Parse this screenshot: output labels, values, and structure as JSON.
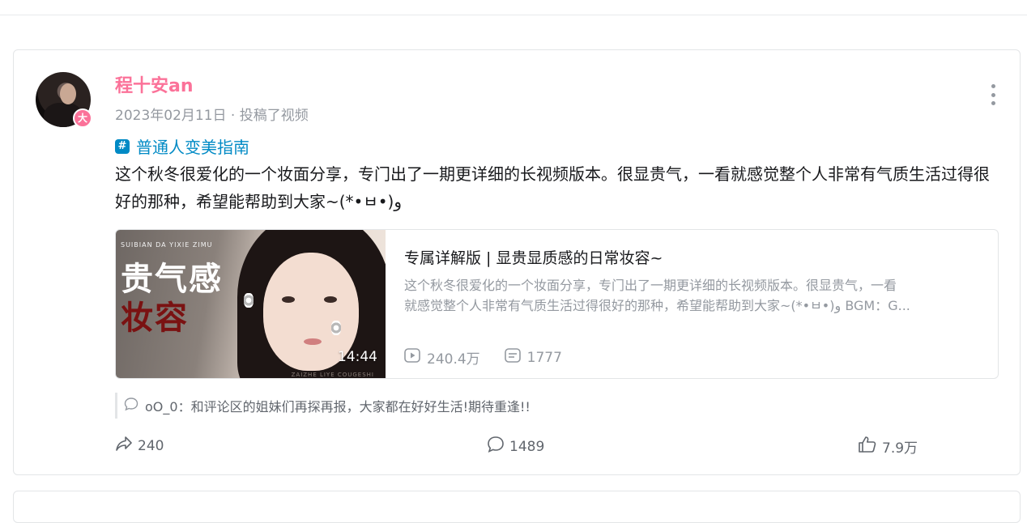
{
  "post": {
    "author": {
      "name": "程十安an",
      "badge": "大"
    },
    "meta": "2023年02月11日 · 投稿了视频",
    "topic": "普通人变美指南",
    "text": "这个秋冬很爱化的一个妆面分享，专门出了一期更详细的长视频版本。很显贵气，一看就感觉整个人非常有气质生活过得很好的那种，希望能帮助到大家~(*•ㅂ•)و"
  },
  "video": {
    "thumbnail": {
      "subtitle": "SUIBIAN DA YIXIE ZIMU",
      "title_line1": "贵气感",
      "title_line2": "妆容",
      "footer": "ZAIZHE LIYE COUGESHI",
      "duration": "14:44"
    },
    "title": "专属详解版 | 显贵显质感的日常妆容~",
    "desc_line1": "这个秋冬很爱化的一个妆面分享，专门出了一期更详细的长视频版本。很显贵气，一看",
    "desc_line2": "就感觉整个人非常有气质生活过得很好的那种，希望能帮助到大家~(*•ㅂ•)و BGM：G...",
    "views": "240.4万",
    "danmaku": "1777"
  },
  "comment_preview": "oO_0：和评论区的姐妹们再探再报，大家都在好好生活!期待重逢!!",
  "actions": {
    "share": "240",
    "comments": "1489",
    "likes": "7.9万"
  },
  "colors": {
    "author_pink": "#fb7299",
    "topic_blue": "#008ac5",
    "muted_gray": "#9499a0"
  }
}
